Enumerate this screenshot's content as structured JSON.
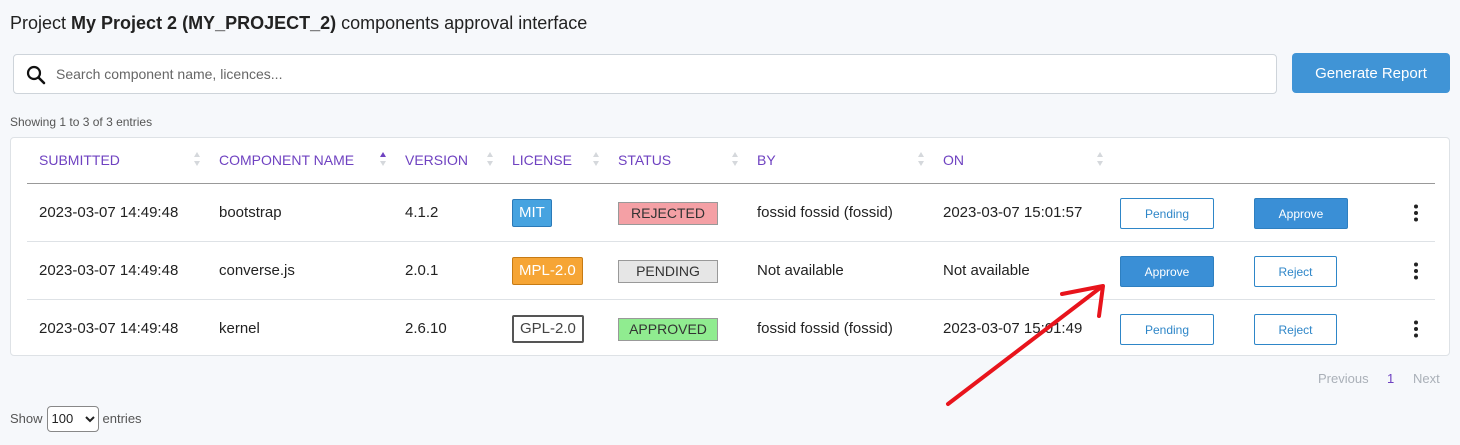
{
  "header": {
    "prefix": "Project ",
    "project_name": "My Project 2 (MY_PROJECT_2)",
    "suffix": " components approval interface"
  },
  "search": {
    "placeholder": "Search component name, licences...",
    "value": ""
  },
  "generate_report_label": "Generate Report",
  "showing_text": "Showing 1 to 3 of 3 entries",
  "columns": [
    "SUBMITTED",
    "COMPONENT NAME",
    "VERSION",
    "LICENSE",
    "STATUS",
    "BY",
    "ON"
  ],
  "sorted_column": "COMPONENT NAME",
  "sort_direction": "asc",
  "rows": [
    {
      "submitted": "2023-03-07 14:49:48",
      "component": "bootstrap",
      "version": "4.1.2",
      "license": "MIT",
      "status": "REJECTED",
      "by": "fossid fossid (fossid)",
      "on": "2023-03-07 15:01:57",
      "action1": "Pending",
      "action2": "Approve"
    },
    {
      "submitted": "2023-03-07 14:49:48",
      "component": "converse.js",
      "version": "2.0.1",
      "license": "MPL-2.0",
      "status": "PENDING",
      "by": "Not available",
      "on": "Not available",
      "action1": "Approve",
      "action2": "Reject"
    },
    {
      "submitted": "2023-03-07 14:49:48",
      "component": "kernel",
      "version": "2.6.10",
      "license": "GPL-2.0",
      "status": "APPROVED",
      "by": "fossid fossid (fossid)",
      "on": "2023-03-07 15:01:49",
      "action1": "Pending",
      "action2": "Reject"
    }
  ],
  "pagination": {
    "previous": "Previous",
    "current": "1",
    "next": "Next"
  },
  "page_length": {
    "label_before": "Show",
    "selected": "100",
    "label_after": "entries"
  },
  "colors": {
    "accent": "#4094d6",
    "header_text": "#6f42c1",
    "rejected": "#f4a0a5",
    "pending": "#e6e6e6",
    "approved": "#90ec90",
    "annotation_arrow": "#e8141c"
  }
}
